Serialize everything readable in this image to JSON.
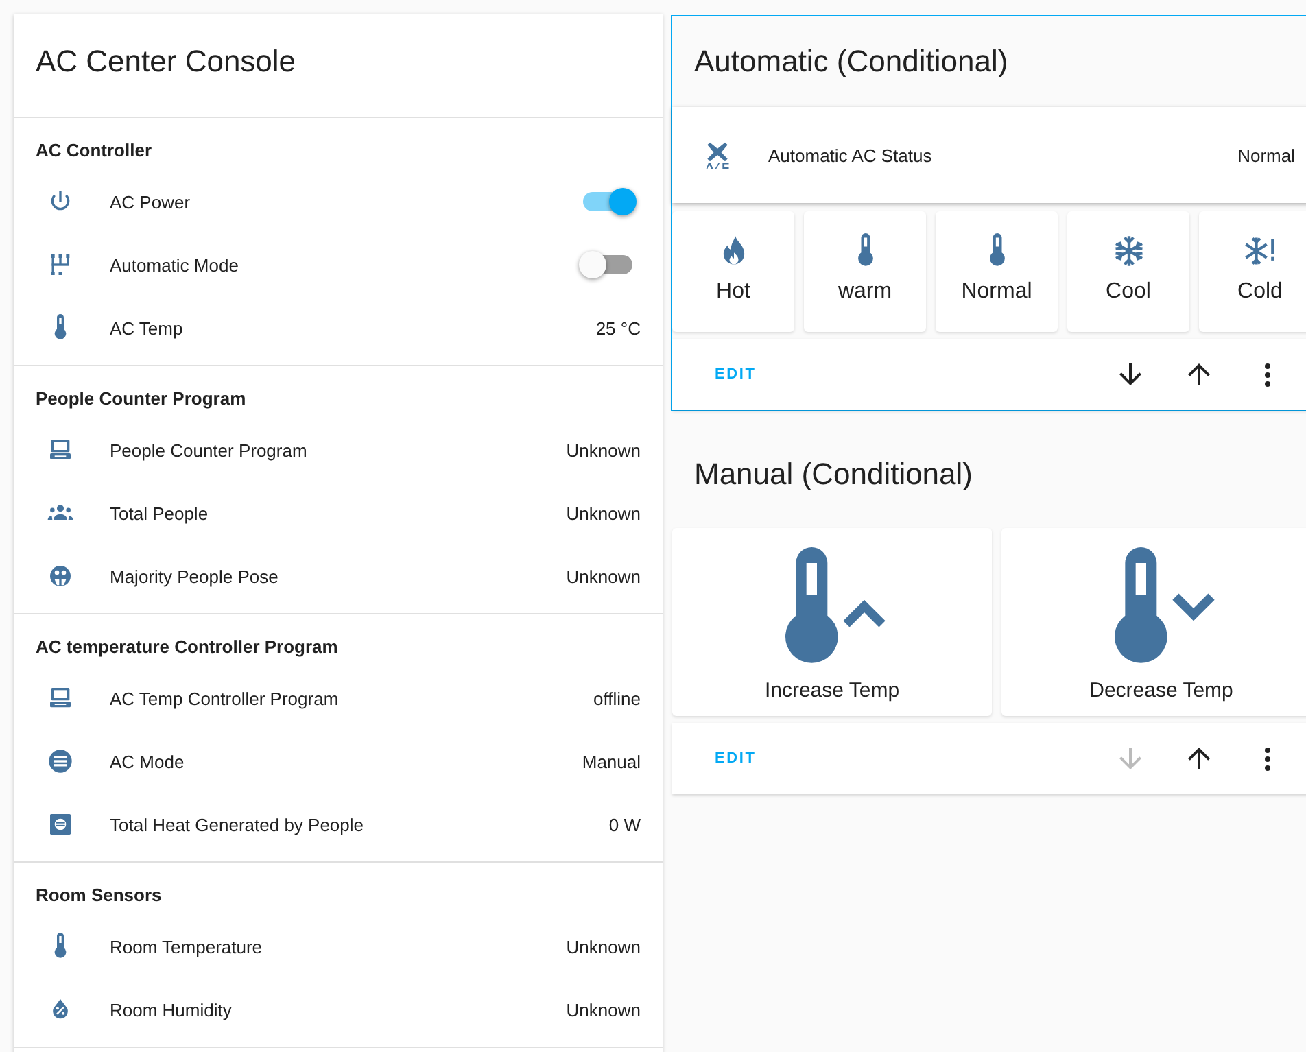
{
  "console": {
    "title": "AC Center Console",
    "sections": [
      {
        "title": "AC Controller",
        "rows": [
          {
            "label": "AC Power",
            "kind": "toggle",
            "on": true
          },
          {
            "label": "Automatic Mode",
            "kind": "toggle",
            "on": false
          },
          {
            "label": "AC Temp",
            "kind": "value",
            "value": "25 °C"
          }
        ]
      },
      {
        "title": "People Counter Program",
        "rows": [
          {
            "label": "People Counter Program",
            "kind": "value",
            "value": "Unknown"
          },
          {
            "label": "Total People",
            "kind": "value",
            "value": "Unknown"
          },
          {
            "label": "Majority People Pose",
            "kind": "value",
            "value": "Unknown"
          }
        ]
      },
      {
        "title": "AC temperature Controller Program",
        "rows": [
          {
            "label": "AC Temp Controller Program",
            "kind": "value",
            "value": "offline"
          },
          {
            "label": "AC Mode",
            "kind": "value",
            "value": "Manual"
          },
          {
            "label": "Total Heat Generated by People",
            "kind": "value",
            "value": "0 W"
          }
        ]
      },
      {
        "title": "Room Sensors",
        "rows": [
          {
            "label": "Room Temperature",
            "kind": "value",
            "value": "Unknown"
          },
          {
            "label": "Room Humidity",
            "kind": "value",
            "value": "Unknown"
          }
        ]
      }
    ]
  },
  "cards": [
    {
      "title": "Automatic (Conditional)",
      "highlighted": true,
      "entity": {
        "label": "Automatic AC Status",
        "value": "Normal"
      },
      "buttons": [
        {
          "label": "Hot"
        },
        {
          "label": "warm"
        },
        {
          "label": "Normal"
        },
        {
          "label": "Cool"
        },
        {
          "label": "Cold"
        }
      ],
      "edit": "EDIT",
      "down_disabled": false,
      "up_disabled": false
    },
    {
      "title": "Manual (Conditional)",
      "highlighted": false,
      "buttons": [
        {
          "label": "Increase Temp"
        },
        {
          "label": "Decrease Temp"
        }
      ],
      "edit": "EDIT",
      "down_disabled": true,
      "up_disabled": false
    }
  ]
}
